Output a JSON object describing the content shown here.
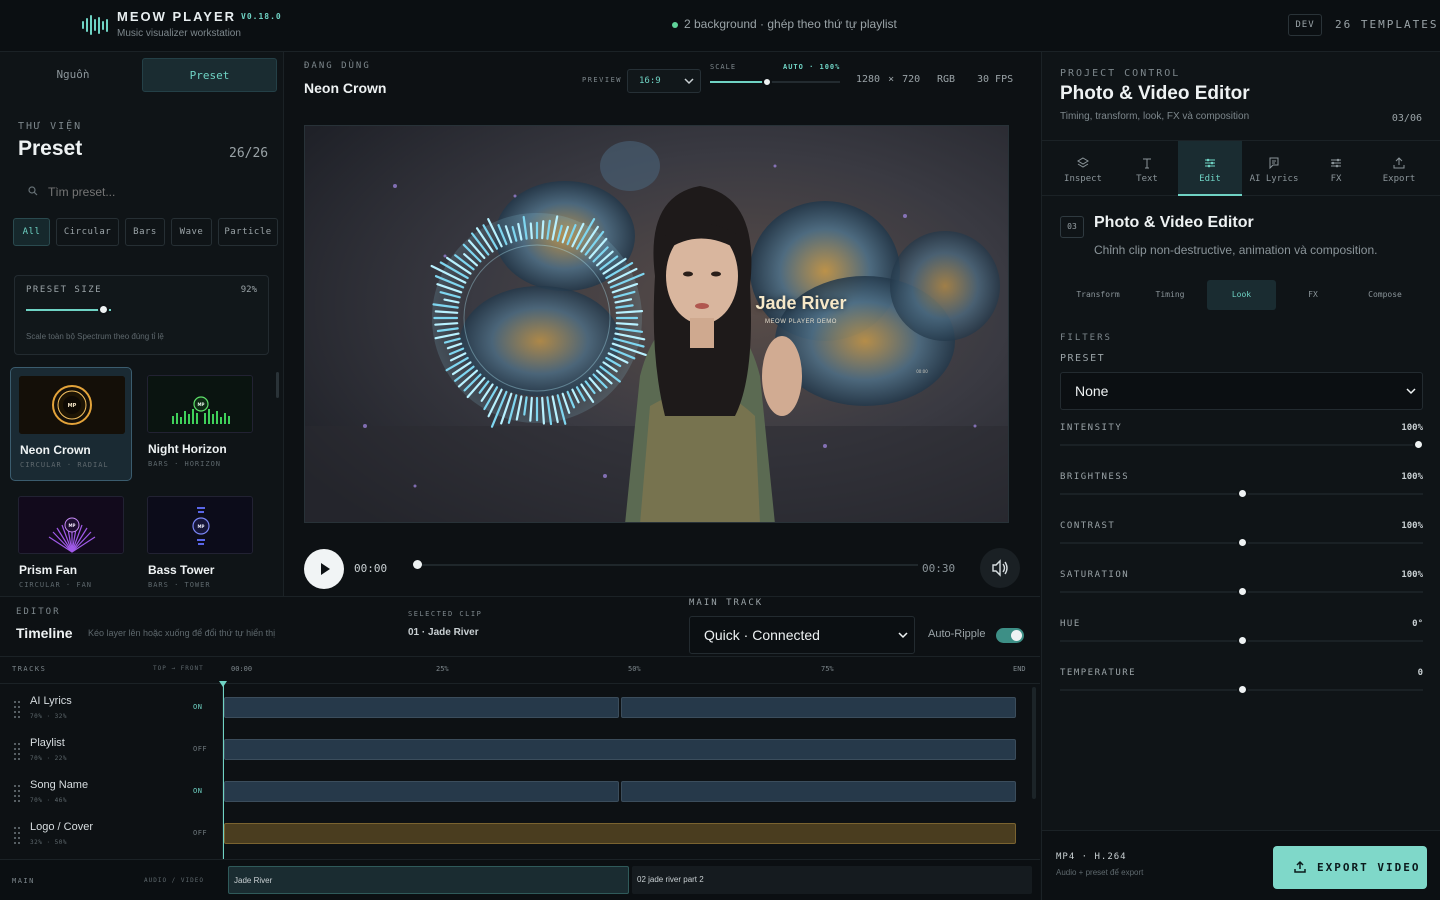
{
  "header": {
    "app_title": "MEOW PLAYER",
    "version": "V0.18.0",
    "subtitle": "Music visualizer workstation",
    "background_status": "2 background · ghép theo thứ tự playlist",
    "env_badge": "DEV",
    "templates_count": "26 TEMPLATES"
  },
  "left": {
    "tabs": [
      {
        "label": "Nguồn"
      },
      {
        "label": "Preset",
        "active": true
      }
    ],
    "library_kicker": "THƯ VIỆN",
    "library_title": "Preset",
    "library_count": "26/26",
    "search_placeholder": "Tìm preset...",
    "chips": [
      {
        "label": "All",
        "active": true
      },
      {
        "label": "Circular"
      },
      {
        "label": "Bars"
      },
      {
        "label": "Wave"
      },
      {
        "label": "Particle"
      }
    ],
    "preset_size": {
      "label": "PRESET SIZE",
      "value_text": "92%",
      "help": "Scale toàn bộ Spectrum theo đúng tỉ lệ"
    },
    "presets": [
      {
        "name": "Neon Crown",
        "tags": "CIRCULAR · RADIAL",
        "selected": true,
        "thumb_label": "MP"
      },
      {
        "name": "Night Horizon",
        "tags": "BARS · HORIZON",
        "thumb_label": "MP"
      },
      {
        "name": "Prism Fan",
        "tags": "CIRCULAR · FAN",
        "thumb_label": "MP"
      },
      {
        "name": "Bass Tower",
        "tags": "BARS · TOWER",
        "thumb_label": "MP"
      }
    ]
  },
  "preview": {
    "kicker": "ĐANG DÙNG",
    "current_preset": "Neon Crown",
    "preview_label": "PREVIEW",
    "ratio": "16:9",
    "scale_label": "SCALE",
    "scale_mode": "AUTO · 100%",
    "scale_value": 1.0,
    "resolution": "1280 × 720",
    "color_mode": "RGB",
    "fps": "30 FPS",
    "clip_title": "Jade River",
    "clip_subtitle": "MEOW PLAYER DEMO",
    "tiny_overlay": "00:00",
    "time_current": "00:00",
    "time_end": "00:30",
    "progress": 0.0
  },
  "right": {
    "kicker": "PROJECT CONTROL",
    "title": "Photo & Video Editor",
    "subtitle": "Timing, transform, look, FX và composition",
    "page": "03/06",
    "tabs": [
      {
        "label": "Inspect",
        "icon": "layers-icon"
      },
      {
        "label": "Text",
        "icon": "text-icon"
      },
      {
        "label": "Edit",
        "icon": "sliders-icon",
        "active": true
      },
      {
        "label": "AI Lyrics",
        "icon": "lyrics-icon"
      },
      {
        "label": "FX",
        "icon": "fx-icon"
      },
      {
        "label": "Export",
        "icon": "export-icon"
      }
    ],
    "section_num": "03",
    "section_title": "Photo & Video Editor",
    "section_sub": "Chỉnh clip non-destructive, animation và composition.",
    "subtabs": [
      {
        "label": "Transform"
      },
      {
        "label": "Timing"
      },
      {
        "label": "Look",
        "active": true
      },
      {
        "label": "FX"
      },
      {
        "label": "Compose"
      }
    ],
    "filters_kicker": "FILTERS",
    "preset_label": "PRESET",
    "filter_preset": "None",
    "sliders": [
      {
        "label": "INTENSITY",
        "value": "100%",
        "level": 1.0
      },
      {
        "label": "BRIGHTNESS",
        "value": "100%",
        "level": 0.5
      },
      {
        "label": "CONTRAST",
        "value": "100%",
        "level": 0.5
      },
      {
        "label": "SATURATION",
        "value": "100%",
        "level": 0.5
      },
      {
        "label": "HUE",
        "value": "0°",
        "level": 0.5
      },
      {
        "label": "TEMPERATURE",
        "value": "0",
        "level": 0.5
      }
    ],
    "export": {
      "format": "MP4 · H.264",
      "sub": "Audio + preset để export",
      "button": "EXPORT VIDEO"
    }
  },
  "timeline": {
    "kicker": "EDITOR",
    "title": "Timeline",
    "help": "Kéo layer lên hoặc xuống để đổi thứ tự hiển thị",
    "selected_clip_label": "SELECTED CLIP",
    "selected_clip": "01 · Jade River",
    "main_track_label": "MAIN TRACK",
    "main_track": "Quick · Connected",
    "ripple_label": "Auto-Ripple",
    "ripple_on": true,
    "head_tracks": "TRACKS",
    "head_order": "TOP → FRONT",
    "ticks": [
      "00:00",
      "25%",
      "50%",
      "75%",
      "END"
    ],
    "tracks": [
      {
        "name": "AI Lyrics",
        "meta": "70% · 32%",
        "state": "ON"
      },
      {
        "name": "Playlist",
        "meta": "70% · 22%",
        "state": "OFF"
      },
      {
        "name": "Song Name",
        "meta": "70% · 46%",
        "state": "ON"
      },
      {
        "name": "Logo / Cover",
        "meta": "32% · 50%",
        "state": "OFF"
      }
    ],
    "main_label": "MAIN",
    "main_type": "AUDIO / VIDEO",
    "main_clips": [
      {
        "label": "Jade River"
      },
      {
        "label": "02 jade river part 2"
      }
    ]
  }
}
